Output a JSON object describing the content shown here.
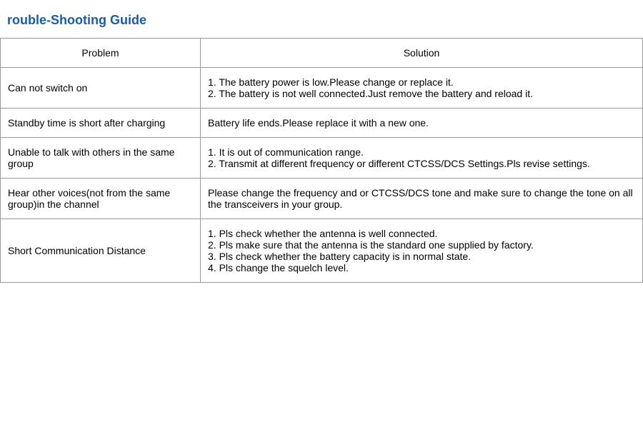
{
  "page": {
    "title": "rouble-Shooting Guide"
  },
  "table": {
    "header": {
      "problem_label": "Problem",
      "solution_label": "Solution"
    },
    "rows": [
      {
        "problem": "Can not switch on",
        "solution": "1. The battery power is low.Please change or replace it.\n2. The battery is not well connected.Just remove the battery and reload it."
      },
      {
        "problem": "Standby time is short after charging",
        "solution": "Battery life ends.Please replace it with a new one."
      },
      {
        "problem": "Unable to talk with others in the same group",
        "solution": "1. It is out of communication range.\n2.  Transmit at different frequency or different CTCSS/DCS Settings.Pls revise settings."
      },
      {
        "problem": "Hear other voices(not from the same group)in the channel",
        "solution": "Please change the frequency and or CTCSS/DCS tone and make sure to change the tone on all the transceivers in your group."
      },
      {
        "problem": "Short Communication Distance",
        "solution": "1. Pls check whether the antenna is well connected.\n2. Pls make sure that the antenna is the standard one supplied by factory.\n3. Pls check whether the battery capacity is in normal state.\n4. Pls change the squelch level."
      }
    ]
  }
}
